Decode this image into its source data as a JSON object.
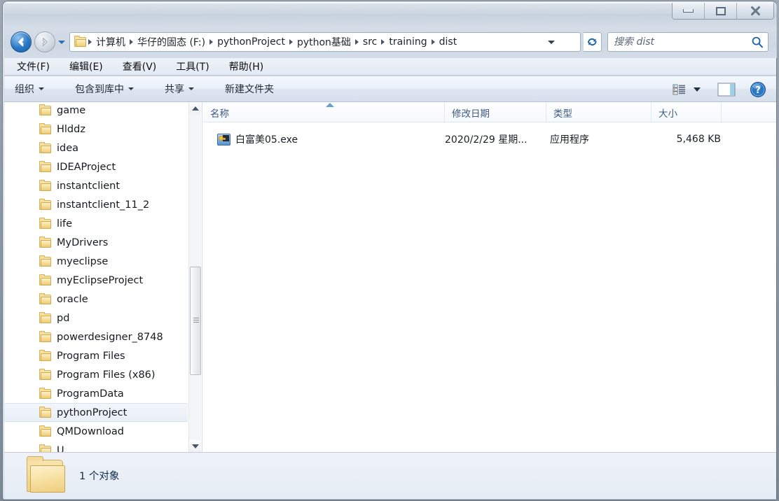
{
  "window": {
    "controls": {
      "minimize_label": "最小化",
      "maximize_label": "最大化",
      "close_label": "关闭"
    }
  },
  "navigation": {
    "back_label": "后退",
    "forward_label": "前进",
    "recent_pages_label": "最近浏览的页面",
    "refresh_label": "刷新",
    "breadcrumbs": [
      "计算机",
      "华仔的固态 (F:)",
      "pythonProject",
      "python基础",
      "src",
      "training",
      "dist"
    ]
  },
  "search": {
    "placeholder": "搜索 dist",
    "value": ""
  },
  "menu": {
    "items": [
      "文件(F)",
      "编辑(E)",
      "查看(V)",
      "工具(T)",
      "帮助(H)"
    ]
  },
  "toolbar": {
    "items": [
      {
        "label": "组织",
        "has_caret": true
      },
      {
        "label": "包含到库中",
        "has_caret": true
      },
      {
        "label": "共享",
        "has_caret": true
      },
      {
        "label": "新建文件夹",
        "has_caret": false
      }
    ],
    "right_icons": [
      "view-options-icon",
      "view-options-caret-icon",
      "preview-pane-icon",
      "help-icon"
    ]
  },
  "nav_pane": {
    "items": [
      {
        "label": "game",
        "selected": false
      },
      {
        "label": "Hlddz",
        "selected": false
      },
      {
        "label": "idea",
        "selected": false
      },
      {
        "label": "IDEAProject",
        "selected": false
      },
      {
        "label": "instantclient",
        "selected": false
      },
      {
        "label": "instantclient_11_2",
        "selected": false
      },
      {
        "label": "life",
        "selected": false
      },
      {
        "label": "MyDrivers",
        "selected": false
      },
      {
        "label": "myeclipse",
        "selected": false
      },
      {
        "label": "myEclipseProject",
        "selected": false
      },
      {
        "label": "oracle",
        "selected": false
      },
      {
        "label": "pd",
        "selected": false
      },
      {
        "label": "powerdesigner_8748",
        "selected": false
      },
      {
        "label": "Program Files",
        "selected": false
      },
      {
        "label": "Program Files (x86)",
        "selected": false
      },
      {
        "label": "ProgramData",
        "selected": false
      },
      {
        "label": "pythonProject",
        "selected": true
      },
      {
        "label": "QMDownload",
        "selected": false
      },
      {
        "label": "U",
        "selected": false
      }
    ]
  },
  "file_list": {
    "columns": [
      {
        "label": "名称",
        "sorted": "asc"
      },
      {
        "label": "修改日期",
        "sorted": ""
      },
      {
        "label": "类型",
        "sorted": ""
      },
      {
        "label": "大小",
        "sorted": ""
      }
    ],
    "rows": [
      {
        "name": "白富美05.exe",
        "modified": "2020/2/29 星期...",
        "type": "应用程序",
        "size": "5,468 KB",
        "icon": "exe-file-icon"
      }
    ]
  },
  "status_bar": {
    "text": "1 个对象",
    "icon": "folder-icon"
  },
  "colors": {
    "accent_blue": "#2a77c4",
    "header_text": "#3d5a82",
    "status_text": "#0d2a4e",
    "folder_yellow": "#f6dc96",
    "selection_bg": "#e9eff7"
  }
}
